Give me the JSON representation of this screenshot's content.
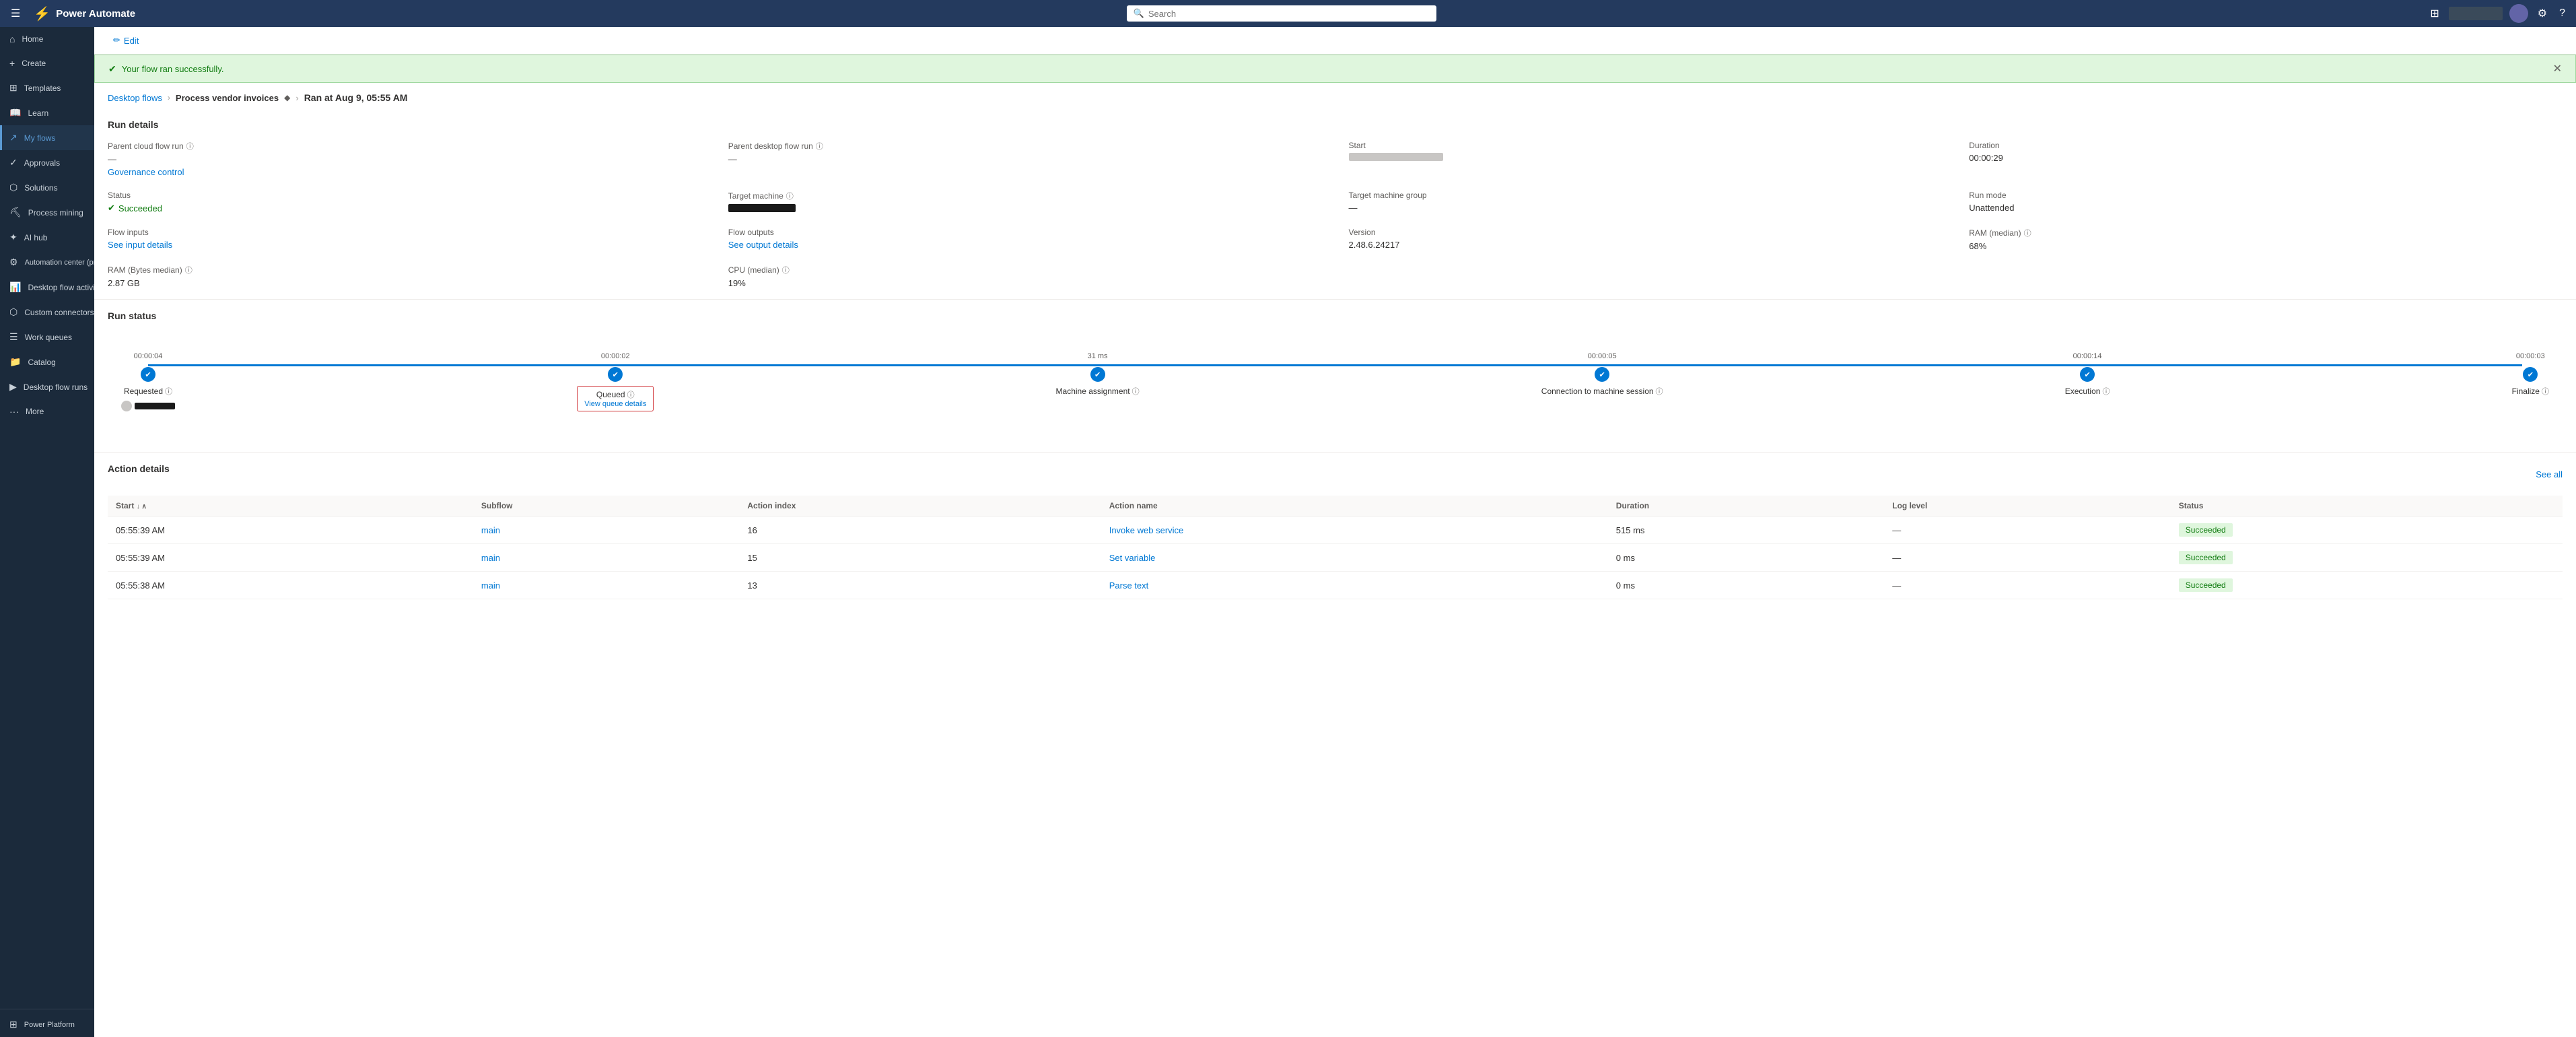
{
  "app": {
    "name": "Power Automate",
    "logo_unicode": "⚡"
  },
  "topnav": {
    "search_placeholder": "Search",
    "env_label": "",
    "hamburger": "☰"
  },
  "sidebar": {
    "items": [
      {
        "id": "home",
        "label": "Home",
        "icon": "⌂",
        "active": false
      },
      {
        "id": "create",
        "label": "Create",
        "icon": "+",
        "active": false
      },
      {
        "id": "templates",
        "label": "Templates",
        "icon": "⊞",
        "active": false
      },
      {
        "id": "learn",
        "label": "Learn",
        "icon": "📖",
        "active": false
      },
      {
        "id": "my-flows",
        "label": "My flows",
        "icon": "↗",
        "active": true
      },
      {
        "id": "approvals",
        "label": "Approvals",
        "icon": "✓",
        "active": false
      },
      {
        "id": "solutions",
        "label": "Solutions",
        "icon": "⬡",
        "active": false
      },
      {
        "id": "process-mining",
        "label": "Process mining",
        "icon": "⛏",
        "active": false
      },
      {
        "id": "ai-hub",
        "label": "AI hub",
        "icon": "✦",
        "active": false
      },
      {
        "id": "automation-center",
        "label": "Automation center (previe...",
        "icon": "⚙",
        "active": false
      },
      {
        "id": "desktop-flow-activity",
        "label": "Desktop flow activity",
        "icon": "📊",
        "active": false
      },
      {
        "id": "custom-connectors",
        "label": "Custom connectors",
        "icon": "⬡",
        "active": false
      },
      {
        "id": "work-queues",
        "label": "Work queues",
        "icon": "☰",
        "active": false
      },
      {
        "id": "catalog",
        "label": "Catalog",
        "icon": "📁",
        "active": false
      },
      {
        "id": "desktop-flow-runs",
        "label": "Desktop flow runs",
        "icon": "▶",
        "active": false
      },
      {
        "id": "more",
        "label": "More",
        "icon": "···",
        "active": false
      }
    ],
    "footer": {
      "label": "Power Platform",
      "icon": "⊞"
    }
  },
  "edit_bar": {
    "button_label": "Edit",
    "icon": "✏"
  },
  "success_banner": {
    "message": "Your flow ran successfully.",
    "icon": "✔"
  },
  "breadcrumb": {
    "link_text": "Desktop flows",
    "separator": "›",
    "flow_name": "Process vendor invoices",
    "flow_icon": "◆",
    "run_info": "Ran at Aug 9, 05:55 AM"
  },
  "run_details": {
    "title": "Run details",
    "fields": [
      {
        "label": "Parent cloud flow run",
        "has_info": true,
        "value": "—",
        "link": "Governance control",
        "is_link_below": true
      },
      {
        "label": "Parent desktop flow run",
        "has_info": true,
        "value": "—",
        "link": null
      },
      {
        "label": "Start",
        "has_info": false,
        "value": "redacted",
        "link": null
      },
      {
        "label": "Duration",
        "has_info": false,
        "value": "00:00:29",
        "link": null
      },
      {
        "label": "Status",
        "has_info": false,
        "value": "Succeeded",
        "is_status": true
      },
      {
        "label": "Target machine",
        "has_info": true,
        "value": "redacted_bar",
        "link": null
      },
      {
        "label": "Target machine group",
        "has_info": false,
        "value": "—",
        "link": null
      },
      {
        "label": "Run mode",
        "has_info": false,
        "value": "Unattended",
        "link": null
      },
      {
        "label": "Flow inputs",
        "has_info": false,
        "value": null,
        "link": "See input details"
      },
      {
        "label": "Flow outputs",
        "has_info": false,
        "value": null,
        "link": "See output details"
      },
      {
        "label": "Version",
        "has_info": false,
        "value": "2.48.6.24217",
        "link": null
      },
      {
        "label": "RAM (median)",
        "has_info": true,
        "value": "68%",
        "link": null
      },
      {
        "label": "RAM (Bytes median)",
        "has_info": true,
        "value": "2.87 GB",
        "link": null
      },
      {
        "label": "CPU (median)",
        "has_info": true,
        "value": "19%",
        "link": null
      }
    ]
  },
  "run_status": {
    "title": "Run status",
    "nodes": [
      {
        "id": "requested",
        "label": "Requested",
        "has_info": true,
        "time_above": "00:00:04",
        "sub_content": "avatar"
      },
      {
        "id": "queued",
        "label": "Queued",
        "has_info": true,
        "time_above": "00:00:02",
        "sub_content": "View queue details",
        "is_highlighted": true
      },
      {
        "id": "machine-assignment",
        "label": "Machine assignment",
        "has_info": true,
        "time_above": "31 ms",
        "sub_content": null
      },
      {
        "id": "connection-to-machine",
        "label": "Connection to machine session",
        "has_info": true,
        "time_above": "00:00:05",
        "sub_content": null
      },
      {
        "id": "execution",
        "label": "Execution",
        "has_info": true,
        "time_above": "00:00:14",
        "sub_content": null
      },
      {
        "id": "finalize",
        "label": "Finalize",
        "has_info": true,
        "time_above": "00:00:03",
        "sub_content": null
      }
    ]
  },
  "action_details": {
    "title": "Action details",
    "see_all": "See all",
    "columns": [
      {
        "id": "start",
        "label": "Start",
        "sortable": true
      },
      {
        "id": "subflow",
        "label": "Subflow",
        "sortable": false
      },
      {
        "id": "action-index",
        "label": "Action index",
        "sortable": false
      },
      {
        "id": "action-name",
        "label": "Action name",
        "sortable": false
      },
      {
        "id": "duration",
        "label": "Duration",
        "sortable": false
      },
      {
        "id": "log-level",
        "label": "Log level",
        "sortable": false
      },
      {
        "id": "status",
        "label": "Status",
        "sortable": false
      }
    ],
    "rows": [
      {
        "start": "05:55:39 AM",
        "subflow": "main",
        "action_index": "16",
        "action_name": "Invoke web service",
        "duration": "515 ms",
        "log_level": "—",
        "status": "Succeeded"
      },
      {
        "start": "05:55:39 AM",
        "subflow": "main",
        "action_index": "15",
        "action_name": "Set variable",
        "duration": "0 ms",
        "log_level": "—",
        "status": "Succeeded"
      },
      {
        "start": "05:55:38 AM",
        "subflow": "main",
        "action_index": "13",
        "action_name": "Parse text",
        "duration": "0 ms",
        "log_level": "—",
        "status": "Succeeded"
      }
    ]
  }
}
